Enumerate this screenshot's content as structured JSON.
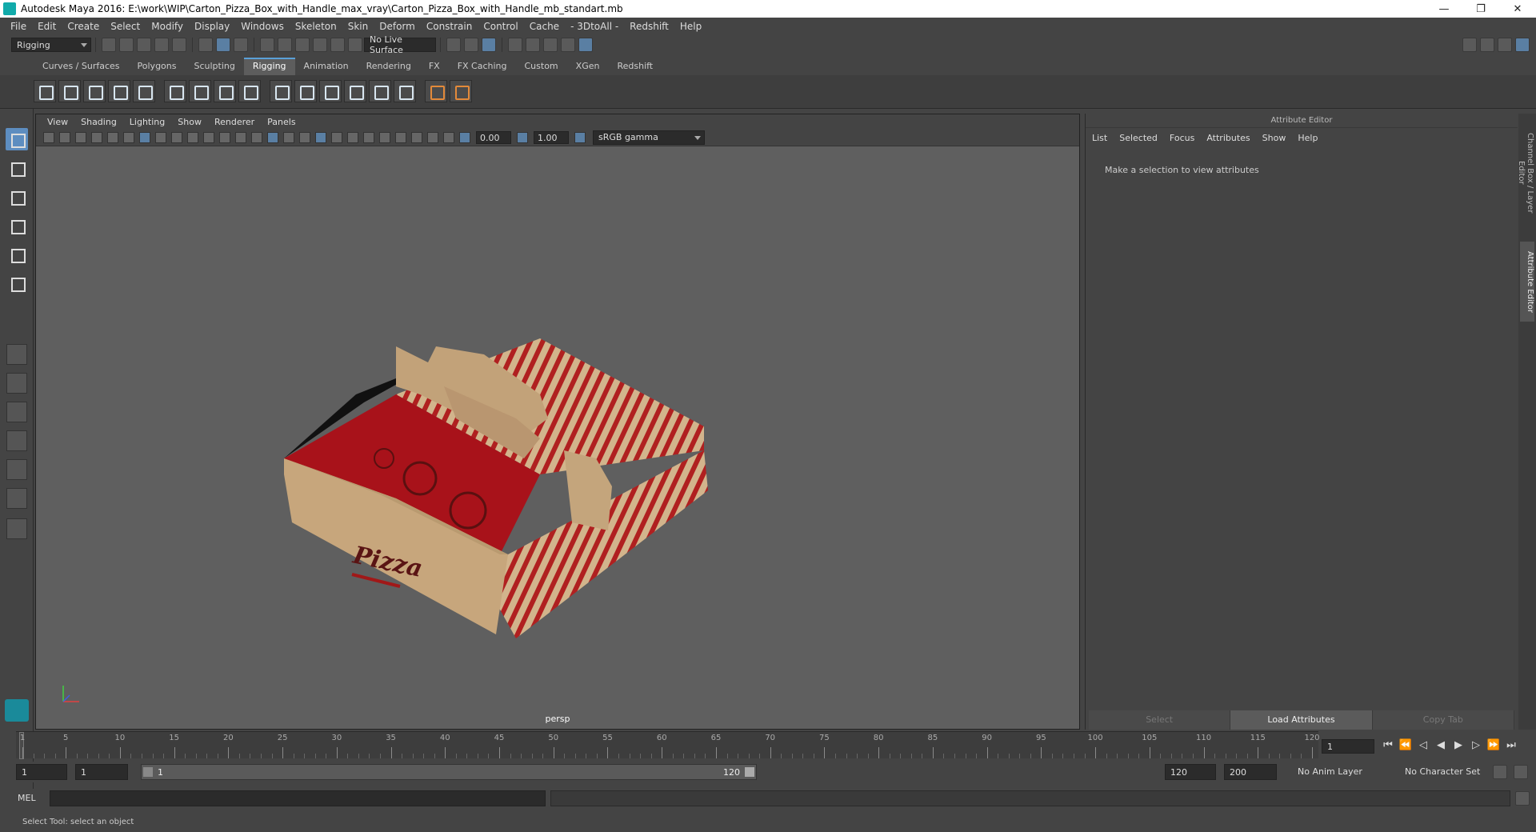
{
  "window": {
    "title": "Autodesk Maya 2016: E:\\work\\WIP\\Carton_Pizza_Box_with_Handle_max_vray\\Carton_Pizza_Box_with_Handle_mb_standart.mb",
    "min": "—",
    "max": "❐",
    "close": "✕"
  },
  "menubar": [
    "File",
    "Edit",
    "Create",
    "Select",
    "Modify",
    "Display",
    "Windows",
    "Skeleton",
    "Skin",
    "Deform",
    "Constrain",
    "Control",
    "Cache",
    "- 3DtoAll -",
    "Redshift",
    "Help"
  ],
  "status": {
    "mode": "Rigging",
    "live_surface": "No Live Surface"
  },
  "shelf_tabs": [
    "Curves / Surfaces",
    "Polygons",
    "Sculpting",
    "Rigging",
    "Animation",
    "Rendering",
    "FX",
    "FX Caching",
    "Custom",
    "XGen",
    "Redshift"
  ],
  "active_shelf": "Rigging",
  "viewport": {
    "menu": [
      "View",
      "Shading",
      "Lighting",
      "Show",
      "Renderer",
      "Panels"
    ],
    "field_a": "0.00",
    "field_b": "1.00",
    "color_space": "sRGB gamma",
    "camera": "persp",
    "logo_text": "Pizza"
  },
  "attribute_editor": {
    "title": "Attribute Editor",
    "menu": [
      "List",
      "Selected",
      "Focus",
      "Attributes",
      "Show",
      "Help"
    ],
    "message": "Make a selection to view attributes",
    "buttons": [
      "Select",
      "Load Attributes",
      "Copy Tab"
    ]
  },
  "side_tabs": [
    "Channel Box / Layer Editor",
    "Attribute Editor"
  ],
  "timeline": {
    "ticks": [
      "1",
      "5",
      "10",
      "15",
      "20",
      "25",
      "30",
      "35",
      "40",
      "45",
      "50",
      "55",
      "60",
      "65",
      "70",
      "75",
      "80",
      "85",
      "90",
      "95",
      "100",
      "105",
      "110",
      "115",
      "120"
    ],
    "current_frame": "1"
  },
  "range": {
    "start": "1",
    "anim_start": "1",
    "slider_start": "1",
    "slider_end": "120",
    "anim_end": "120",
    "end": "200",
    "anim_layer": "No Anim Layer",
    "character_set": "No Character Set"
  },
  "command": {
    "label": "MEL"
  },
  "help_line": "Select Tool: select an object"
}
